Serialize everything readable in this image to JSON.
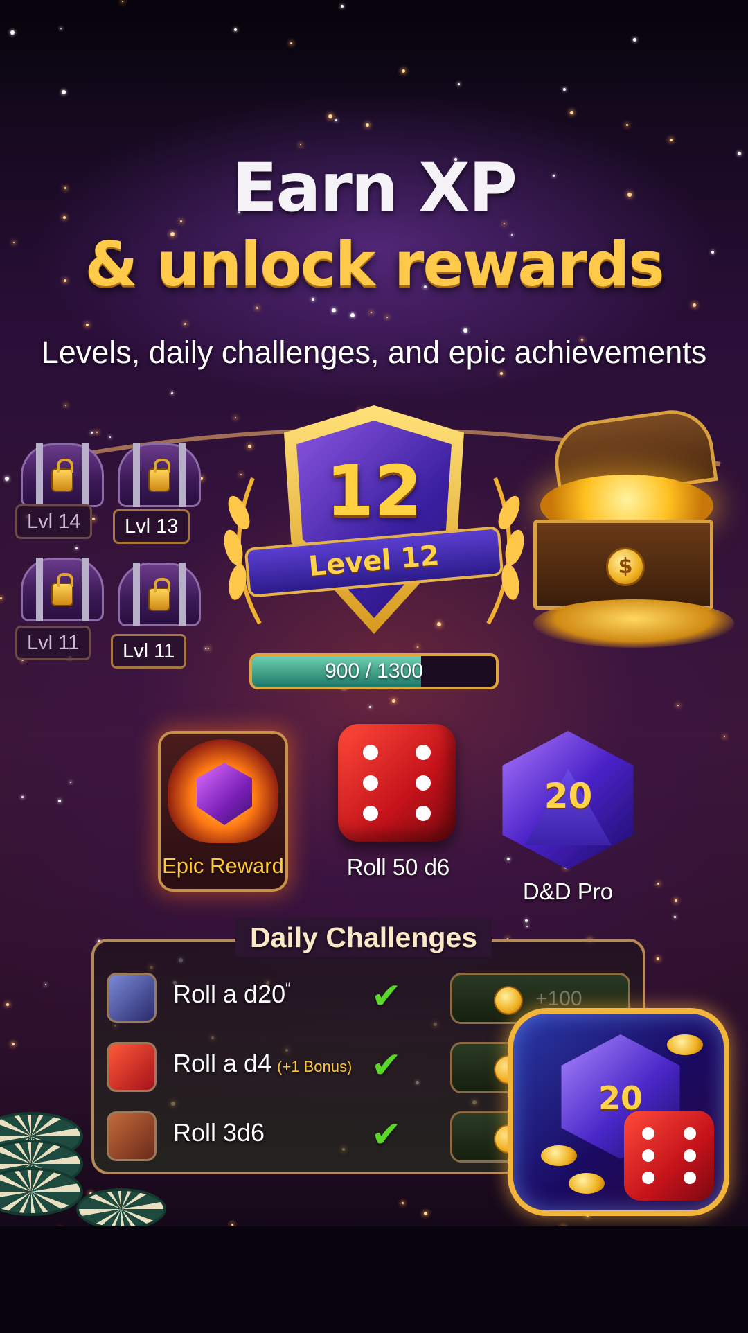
{
  "header": {
    "title_line1": "Earn XP",
    "title_line2": "& unlock rewards",
    "subtitle": "Levels, daily challenges, and epic achievements"
  },
  "locked_chests": [
    {
      "label": "Lvl 14"
    },
    {
      "label": "Lvl 13"
    },
    {
      "label": "Lvl 11"
    },
    {
      "label": "Lvl 11"
    }
  ],
  "level": {
    "number": "12",
    "ribbon": "Level 12",
    "xp_text": "900 / 1300",
    "xp_current": 900,
    "xp_total": 1300
  },
  "treasure": {
    "coin_symbol": "$"
  },
  "rewards": [
    {
      "label": "Epic Reward",
      "icon": "flaming-gem-icon"
    },
    {
      "label": "Roll 50 d6",
      "icon": "red-d6-die-icon"
    },
    {
      "label": "D&D Pro",
      "icon": "purple-d20-die-icon"
    }
  ],
  "daily_challenges": {
    "title": "Daily Challenges",
    "items": [
      {
        "label": "Roll a d20",
        "suffix": "“",
        "bonus": "",
        "icon": "d20-icon",
        "completed": true
      },
      {
        "label": "Roll a d4",
        "suffix": "",
        "bonus": "(+1 Bonus)",
        "icon": "d6-icon",
        "completed": true
      },
      {
        "label": "Roll 3d6",
        "suffix": "",
        "bonus": "",
        "icon": "d16-icon",
        "completed": true
      }
    ],
    "claim_text": "+100",
    "check_symbol": "✔"
  },
  "app_icon": {
    "d20_number": "20"
  },
  "d20_number": "20",
  "colors": {
    "gold": "#ffc94a",
    "purple": "#4a22c8",
    "red_die": "#c4121a",
    "check_green": "#5ad82a"
  }
}
